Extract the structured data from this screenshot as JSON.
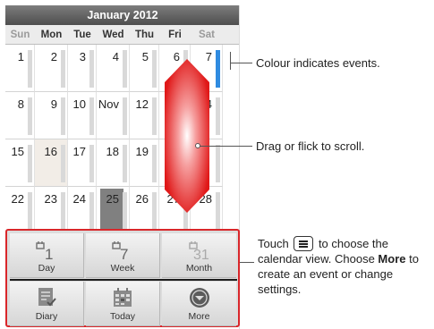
{
  "calendar": {
    "title": "January 2012",
    "weekdays": [
      "Sun",
      "Mon",
      "Tue",
      "Wed",
      "Thu",
      "Fri",
      "Sat"
    ],
    "weeks": [
      [
        "1",
        "2",
        "3",
        "4",
        "5",
        "6",
        "7"
      ],
      [
        "8",
        "9",
        "10",
        "Nov",
        "12",
        "",
        "14"
      ],
      [
        "15",
        "16",
        "17",
        "18",
        "19",
        "",
        ""
      ],
      [
        "22",
        "23",
        "24",
        "25",
        "26",
        "27",
        "28"
      ]
    ],
    "today": "16",
    "selected": "25",
    "event_day": "7"
  },
  "menu": {
    "items": [
      {
        "label": "Day",
        "icon": "day-view-icon",
        "glyph": "1"
      },
      {
        "label": "Week",
        "icon": "week-view-icon",
        "glyph": "7"
      },
      {
        "label": "Month",
        "icon": "month-view-icon",
        "glyph": "31"
      },
      {
        "label": "Diary",
        "icon": "diary-icon",
        "glyph": ""
      },
      {
        "label": "Today",
        "icon": "today-icon",
        "glyph": ""
      },
      {
        "label": "More",
        "icon": "more-icon",
        "glyph": ""
      }
    ]
  },
  "callouts": {
    "events": "Colour indicates events.",
    "scroll": "Drag or flick to scroll.",
    "menu_touch": "Touch",
    "menu_rest": " to choose the calendar view. Choose ",
    "menu_more": "More",
    "menu_end": " to create an event or change settings."
  },
  "colors": {
    "highlight_red": "#d9262a",
    "event_blue": "#2f8be0"
  }
}
